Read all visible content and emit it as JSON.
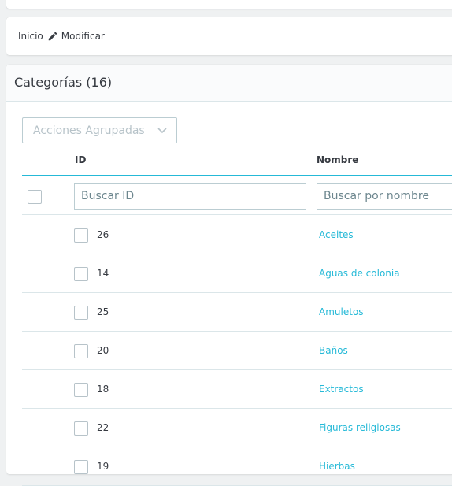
{
  "breadcrumb": {
    "home": "Inicio",
    "current": "Modificar"
  },
  "panel": {
    "title": "Categorías (16)"
  },
  "bulk_actions": {
    "label": "Acciones Agrupadas"
  },
  "table": {
    "columns": {
      "id": "ID",
      "name": "Nombre"
    },
    "filters": {
      "id_placeholder": "Buscar ID",
      "name_placeholder": "Buscar por nombre"
    },
    "rows": [
      {
        "id": "26",
        "name": "Aceites"
      },
      {
        "id": "14",
        "name": "Aguas de colonia"
      },
      {
        "id": "25",
        "name": "Amuletos"
      },
      {
        "id": "20",
        "name": "Baños"
      },
      {
        "id": "18",
        "name": "Extractos"
      },
      {
        "id": "22",
        "name": "Figuras religiosas"
      },
      {
        "id": "19",
        "name": "Hierbas"
      }
    ]
  },
  "colors": {
    "accent": "#25b9d7",
    "text": "#363a41",
    "border": "#bbcdd2"
  },
  "icons": {
    "edit": "pencil-icon",
    "dropdown": "chevron-down-icon"
  }
}
